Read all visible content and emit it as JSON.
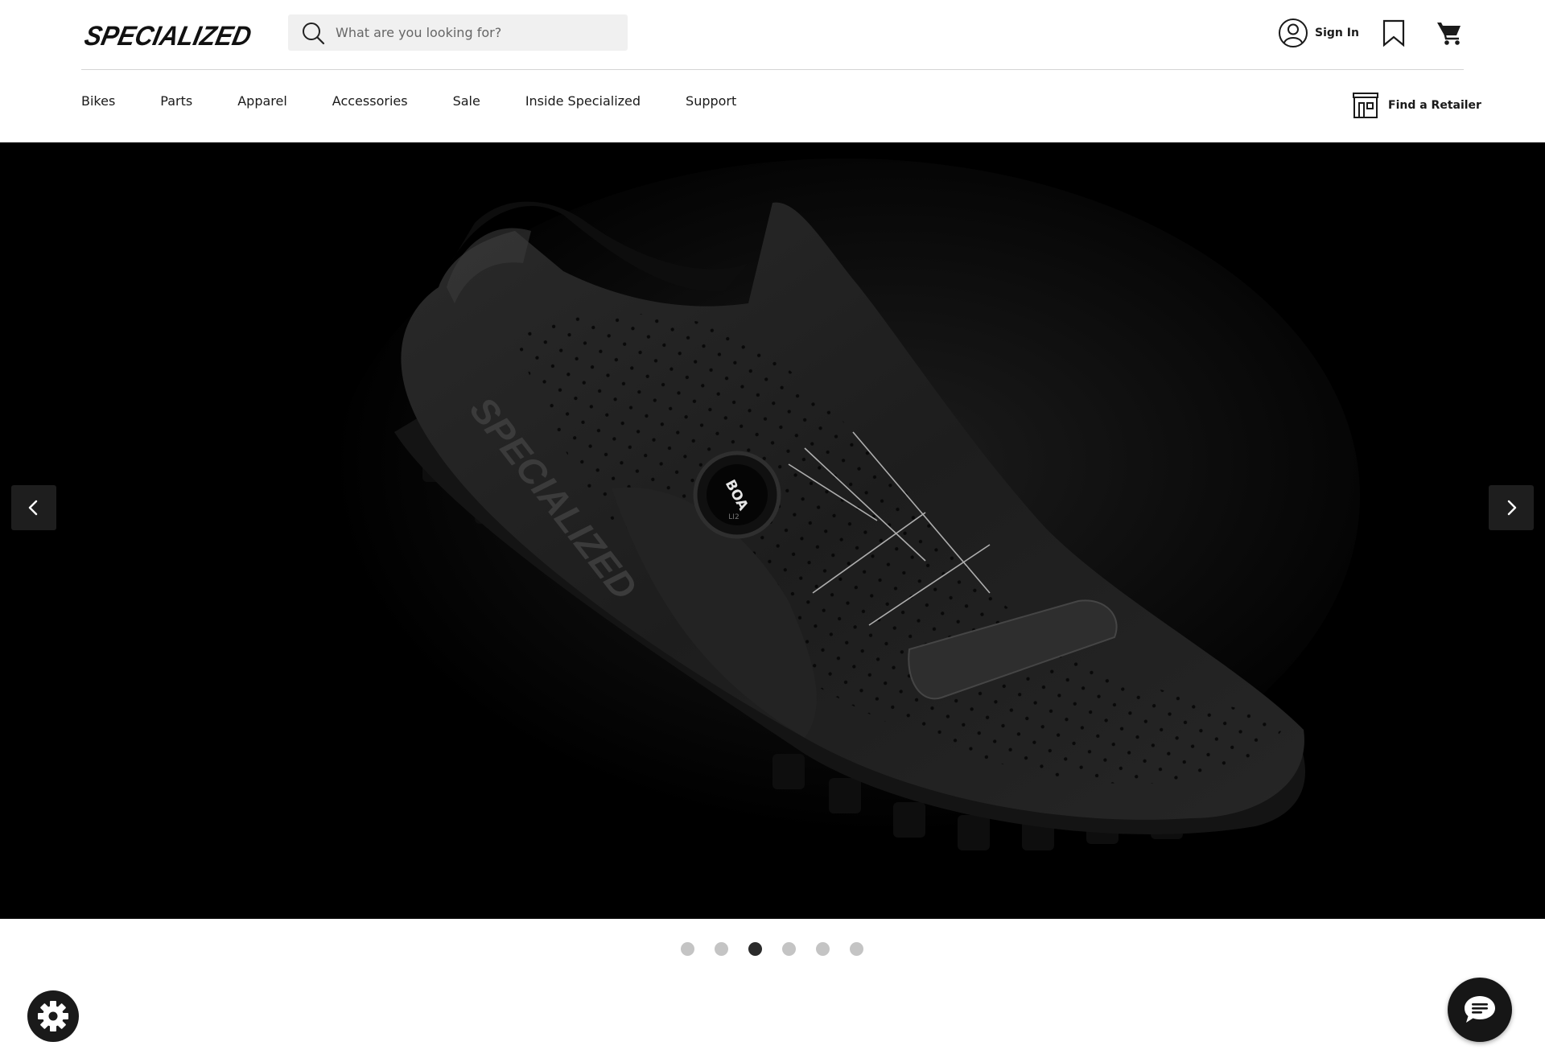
{
  "header": {
    "logo_text": "SPECIALIZED",
    "search": {
      "placeholder": "What are you looking for?",
      "value": ""
    },
    "account_label": "Sign In",
    "icons": [
      "search-icon",
      "user-icon",
      "bookmark-icon",
      "cart-icon",
      "store-icon"
    ]
  },
  "nav": {
    "items": [
      "Bikes",
      "Parts",
      "Apparel",
      "Accessories",
      "Sale",
      "Inside Specialized",
      "Support"
    ],
    "retailer_label": "Find a Retailer"
  },
  "hero": {
    "shoe_brand_text": "SPECIALIZED",
    "dial_text": "BOA",
    "dial_subtext": "LI2",
    "background": "#000000",
    "prev_icon": "chevron-left-icon",
    "next_icon": "chevron-right-icon"
  },
  "carousel": {
    "slide_count": 6,
    "active_index": 2,
    "dot_color": "#c4c4c4",
    "active_dot_color": "#2b2b2b"
  },
  "widgets": {
    "settings_icon": "gear-icon",
    "chat_icon": "chat-icon"
  }
}
